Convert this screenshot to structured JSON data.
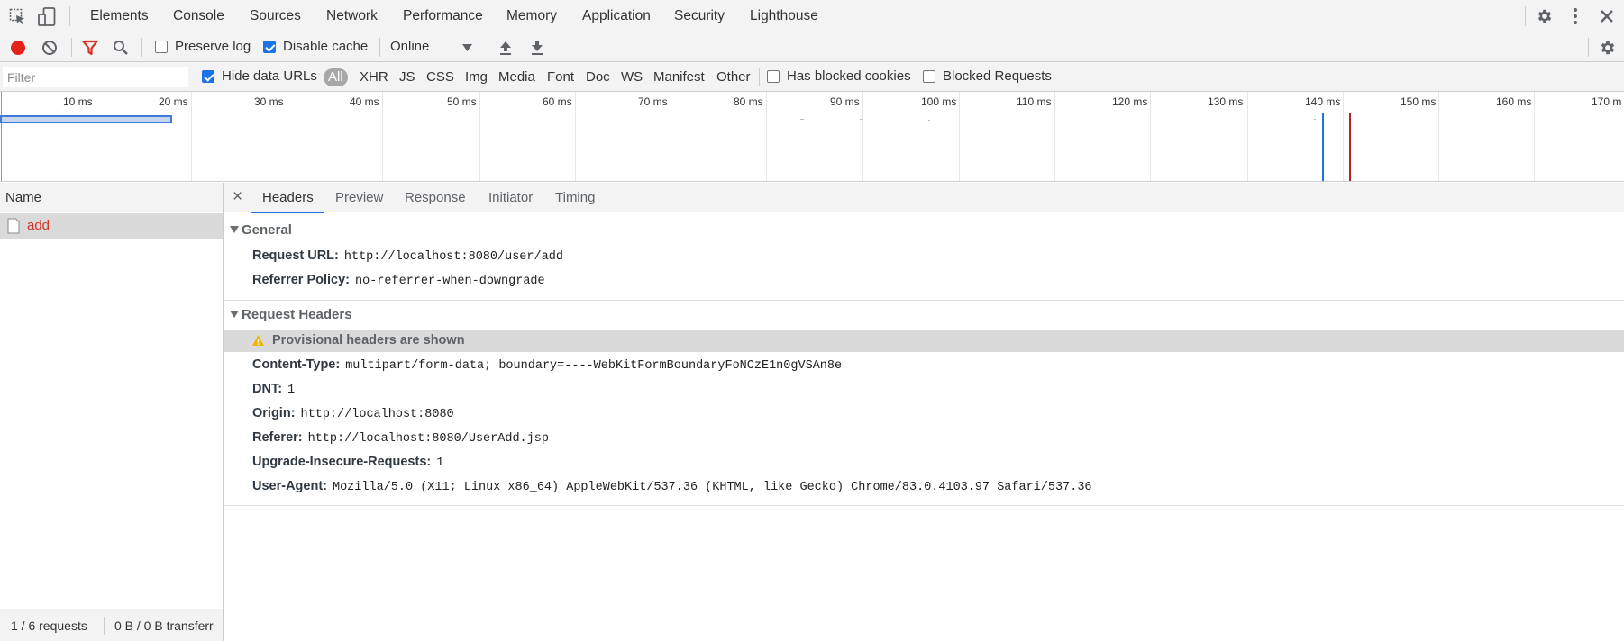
{
  "devtools": {
    "tabs": [
      "Elements",
      "Console",
      "Sources",
      "Network",
      "Performance",
      "Memory",
      "Application",
      "Security",
      "Lighthouse"
    ],
    "active_tab": "Network"
  },
  "toolbar": {
    "preserve_log_label": "Preserve log",
    "preserve_log_checked": false,
    "disable_cache_label": "Disable cache",
    "disable_cache_checked": true,
    "throttling_value": "Online"
  },
  "filterbar": {
    "filter_placeholder": "Filter",
    "hide_data_urls_label": "Hide data URLs",
    "hide_data_urls_checked": true,
    "types": [
      "All",
      "XHR",
      "JS",
      "CSS",
      "Img",
      "Media",
      "Font",
      "Doc",
      "WS",
      "Manifest",
      "Other"
    ],
    "active_type": "All",
    "has_blocked_cookies_label": "Has blocked cookies",
    "blocked_requests_label": "Blocked Requests"
  },
  "timeline": {
    "ticks": [
      "10 ms",
      "20 ms",
      "30 ms",
      "40 ms",
      "50 ms",
      "60 ms",
      "70 ms",
      "80 ms",
      "90 ms",
      "100 ms",
      "110 ms",
      "120 ms",
      "130 ms",
      "140 ms",
      "150 ms",
      "160 ms",
      "170 m"
    ]
  },
  "requests": {
    "column_name": "Name",
    "items": [
      {
        "name": "add",
        "status": "error"
      }
    ]
  },
  "status_bar": {
    "requests": "1 / 6 requests",
    "transferred": "0 B / 0 B transferr"
  },
  "detail": {
    "close_glyph": "×",
    "tabs": [
      "Headers",
      "Preview",
      "Response",
      "Initiator",
      "Timing"
    ],
    "active_tab": "Headers",
    "general": {
      "title": "General",
      "rows": [
        {
          "key": "Request URL:",
          "value": "http://localhost:8080/user/add"
        },
        {
          "key": "Referrer Policy:",
          "value": "no-referrer-when-downgrade"
        }
      ]
    },
    "request_headers": {
      "title": "Request Headers",
      "warning": "Provisional headers are shown",
      "rows": [
        {
          "key": "Content-Type:",
          "value": "multipart/form-data; boundary=----WebKitFormBoundaryFoNCzE1n0gVSAn8e"
        },
        {
          "key": "DNT:",
          "value": "1"
        },
        {
          "key": "Origin:",
          "value": "http://localhost:8080"
        },
        {
          "key": "Referer:",
          "value": "http://localhost:8080/UserAdd.jsp"
        },
        {
          "key": "Upgrade-Insecure-Requests:",
          "value": "1"
        },
        {
          "key": "User-Agent:",
          "value": "Mozilla/5.0 (X11; Linux x86_64) AppleWebKit/537.36 (KHTML, like Gecko) Chrome/83.0.4103.97 Safari/537.36"
        }
      ]
    }
  },
  "colors": {
    "accent": "#1a73e8",
    "record_red": "#e2231a",
    "error_red": "#d93025",
    "warning_yellow": "#f2b400"
  },
  "icons": {
    "inspect": "inspect-element-icon",
    "device": "device-toolbar-icon",
    "settings": "gear-icon",
    "more": "vertical-dots-icon",
    "close": "close-icon",
    "record": "record-icon",
    "clear": "clear-icon",
    "filter": "funnel-icon",
    "search": "search-icon",
    "import": "upload-icon",
    "export": "download-icon",
    "file": "document-icon",
    "warning": "warning-icon"
  }
}
